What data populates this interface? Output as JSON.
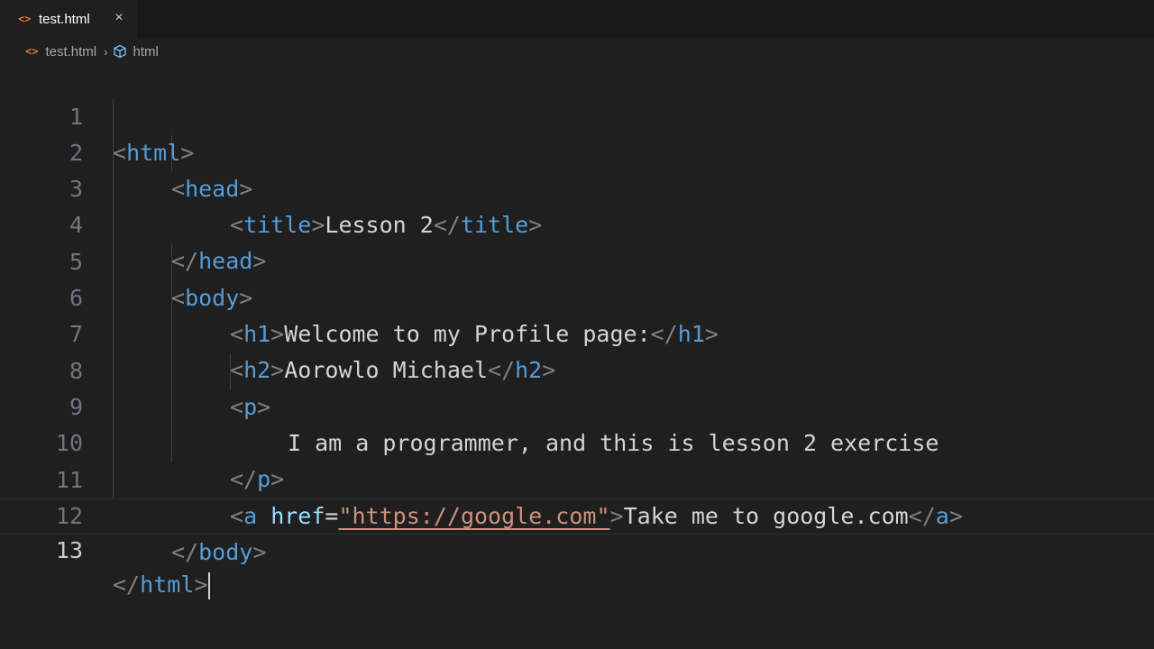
{
  "tab": {
    "icon": "html-file-icon",
    "label": "test.html",
    "close": "×"
  },
  "breadcrumb": {
    "file": "test.html",
    "separator": "›",
    "symbol": "html"
  },
  "editor": {
    "line_numbers": [
      "1",
      "2",
      "3",
      "4",
      "5",
      "6",
      "7",
      "8",
      "9",
      "10",
      "11",
      "12",
      "13"
    ],
    "current_line": 13,
    "colors": {
      "tag_punctuation": "#808080",
      "tag_name": "#569cd6",
      "attribute": "#9cdcfe",
      "string": "#ce9178",
      "text": "#d4d4d4"
    },
    "lines": {
      "l1": {
        "open": "<",
        "tag": "html",
        "close": ">"
      },
      "l2": {
        "open": "<",
        "tag": "head",
        "close": ">"
      },
      "l3": {
        "open": "<",
        "tag": "title",
        "close": ">",
        "text": "Lesson 2",
        "end_open": "</",
        "end_tag": "title",
        "end_close": ">"
      },
      "l4": {
        "open": "</",
        "tag": "head",
        "close": ">"
      },
      "l5": {
        "open": "<",
        "tag": "body",
        "close": ">"
      },
      "l6": {
        "open": "<",
        "tag": "h1",
        "close": ">",
        "text": "Welcome to my Profile page:",
        "end_open": "</",
        "end_tag": "h1",
        "end_close": ">"
      },
      "l7": {
        "open": "<",
        "tag": "h2",
        "close": ">",
        "text": "Aorowlo Michael",
        "end_open": "</",
        "end_tag": "h2",
        "end_close": ">"
      },
      "l8": {
        "open": "<",
        "tag": "p",
        "close": ">"
      },
      "l9": {
        "text": "I am a programmer, and this is lesson 2 exercise"
      },
      "l10": {
        "open": "</",
        "tag": "p",
        "close": ">"
      },
      "l11": {
        "open": "<",
        "tag": "a",
        "attr": "href",
        "eq": "=",
        "quote": "\"",
        "value": "https://google.com",
        "close": ">",
        "text": "Take me to google.com",
        "end_open": "</",
        "end_tag": "a",
        "end_close": ">"
      },
      "l12": {
        "open": "</",
        "tag": "body",
        "close": ">"
      },
      "l13": {
        "open": "</",
        "tag": "html",
        "close": ">"
      }
    }
  }
}
